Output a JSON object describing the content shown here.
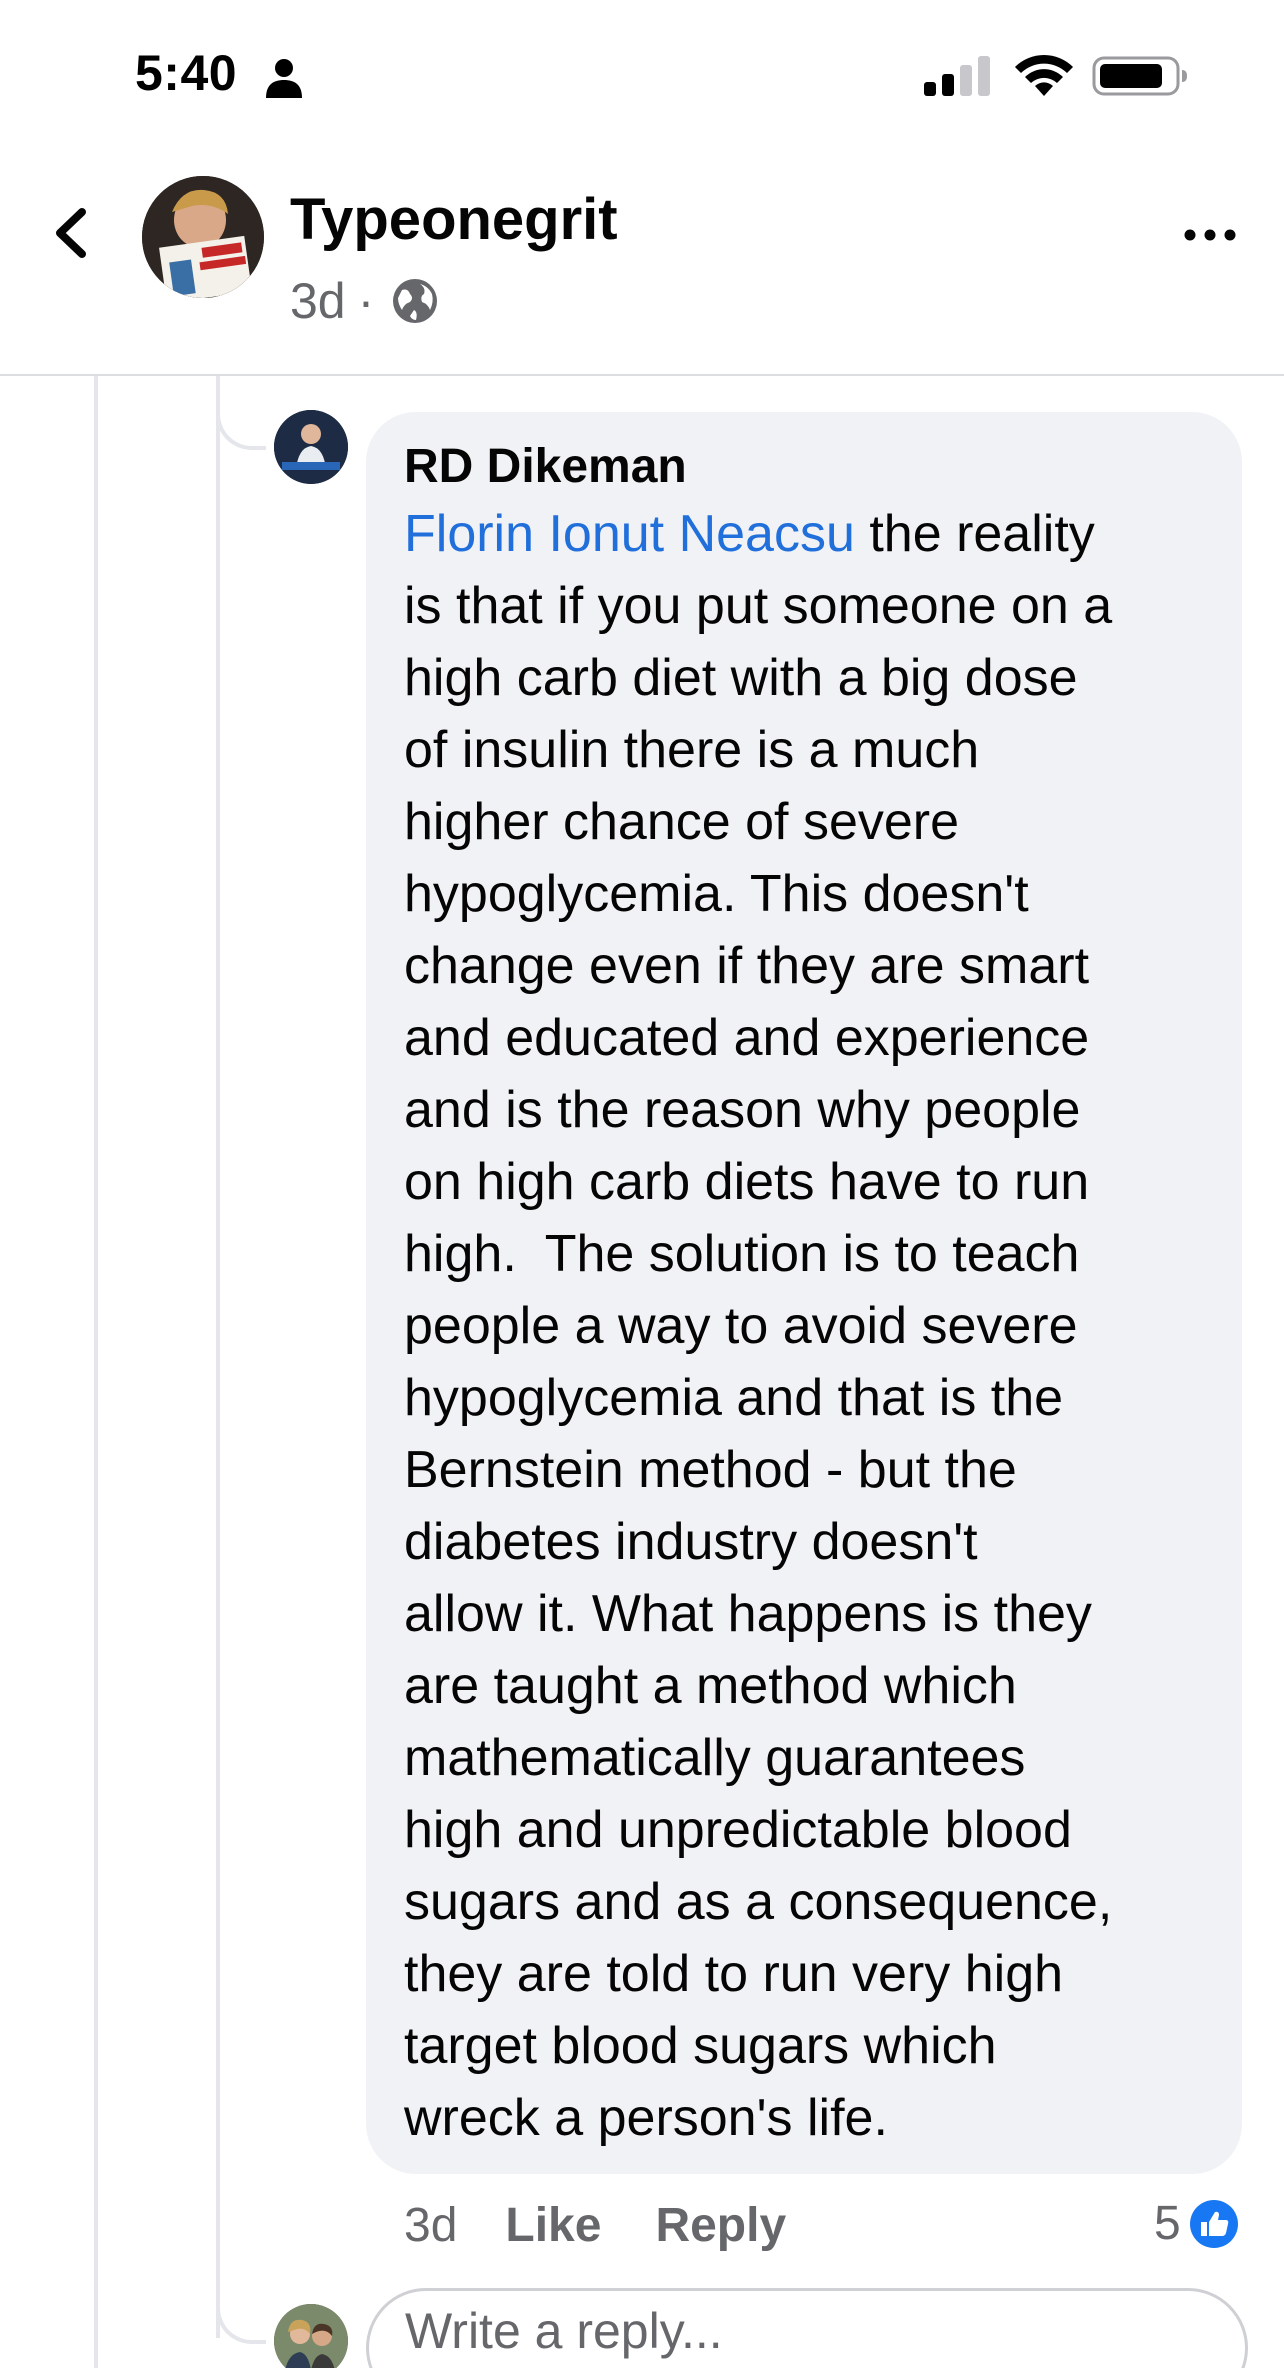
{
  "status_bar": {
    "time": "5:40",
    "icons": [
      "person-icon",
      "signal-icon",
      "wifi-icon",
      "battery-icon"
    ]
  },
  "header": {
    "back_icon": "chevron-left-icon",
    "name": "Typeonegrit",
    "age": "3d",
    "separator": "·",
    "privacy_icon": "globe-icon",
    "more_icon": "more-horizontal-icon"
  },
  "comment": {
    "author": "RD Dikeman",
    "mention": "Florin Ionut Neacsu",
    "lines": [
      " the reality",
      "is that if you put someone on a",
      "high carb diet with a big dose",
      "of insulin there is a much",
      "higher chance of severe",
      "hypoglycemia. This doesn't",
      "change even if they are smart",
      "and educated and experience",
      "and is the reason why people",
      "on high carb diets have to run",
      "high.  The solution is to teach",
      "people a way to avoid severe",
      "hypoglycemia and that is the",
      "Bernstein method - but the",
      "diabetes industry doesn't",
      "allow it. What happens is they",
      "are taught a method which",
      "mathematically guarantees",
      "high and unpredictable blood",
      "sugars and as a consequence,",
      "they are told to run very high",
      "target blood sugars which",
      "wreck a person's life."
    ],
    "time": "3d",
    "like_label": "Like",
    "reply_label": "Reply",
    "reaction_count": "5",
    "reaction_icon": "like-reaction-icon"
  },
  "composer": {
    "placeholder": "Write a reply..."
  },
  "colors": {
    "mention": "#216fdb",
    "bubble": "#f0f2f5",
    "secondary_text": "#65676b",
    "like_blue": "#1877f2"
  }
}
